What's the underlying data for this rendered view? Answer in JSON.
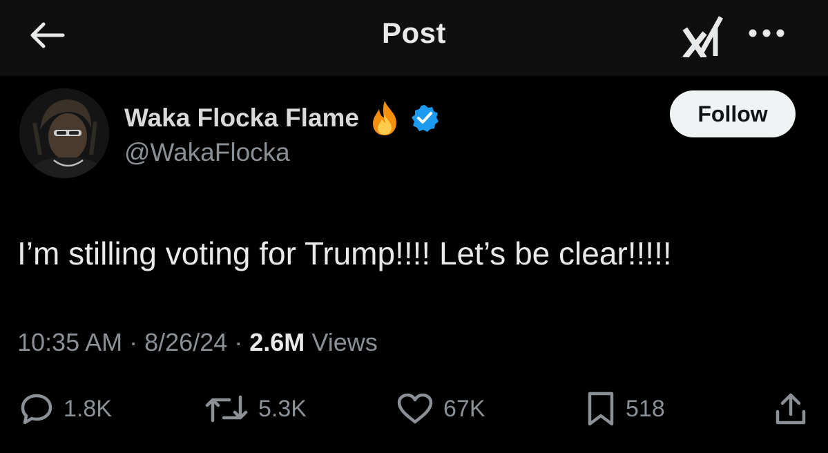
{
  "header": {
    "title": "Post",
    "back_icon": "arrow-left-icon",
    "grok_icon": "grok-icon",
    "more_icon": "more-horizontal-icon"
  },
  "author": {
    "display_name": "Waka Flocka Flame",
    "emoji": "fire-icon",
    "verified_icon": "verified-badge-icon",
    "verified_color": "#1d9bf0",
    "handle": "@WakaFlocka",
    "follow_label": "Follow"
  },
  "post": {
    "text": "I’m stilling voting for Trump!!!! Let’s be clear!!!!!",
    "time": "10:35 AM",
    "date": "8/26/24",
    "views_count": "2.6M",
    "views_label": "Views"
  },
  "actions": {
    "replies": "1.8K",
    "reposts": "5.3K",
    "likes": "67K",
    "bookmarks": "518"
  }
}
